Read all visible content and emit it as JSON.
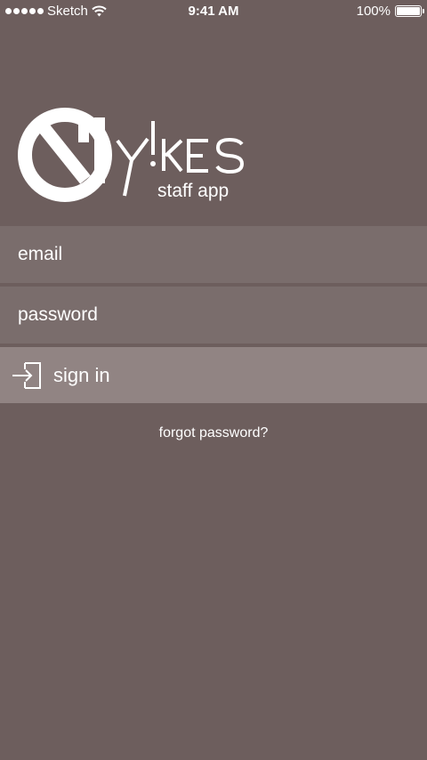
{
  "status_bar": {
    "carrier": "Sketch",
    "time": "9:41 AM",
    "battery": "100%"
  },
  "logo": {
    "wordmark": "y!KES",
    "tagline": "staff app"
  },
  "form": {
    "email_placeholder": "email",
    "password_placeholder": "password",
    "signin_label": "sign in",
    "forgot_label": "forgot password?"
  },
  "colors": {
    "background": "#6d5e5d",
    "field": "#7a6d6c",
    "button": "#918483",
    "text": "#ffffff"
  },
  "icons": {
    "signal": "signal-dots-icon",
    "wifi": "wifi-icon",
    "battery": "battery-icon",
    "logo_mark": "no-symbol-icon",
    "signin": "sign-in-icon"
  }
}
